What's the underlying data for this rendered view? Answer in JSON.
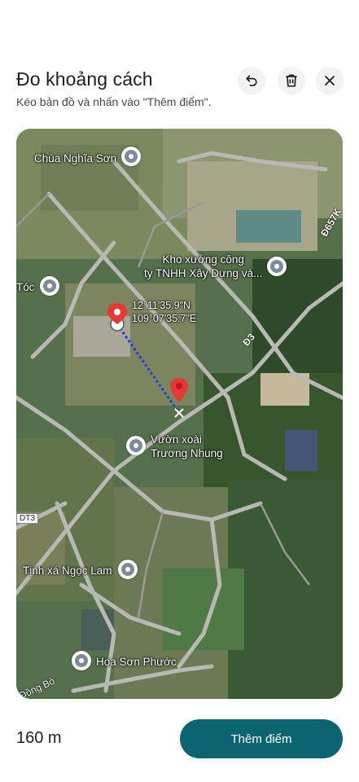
{
  "header": {
    "title": "Đo khoảng cách",
    "subtitle": "Kéo bản đồ và nhấn vào \"Thêm điểm\"."
  },
  "toolbar": {
    "undo_icon": "undo-icon",
    "delete_icon": "trash-icon",
    "close_icon": "close-icon"
  },
  "map": {
    "places": [
      {
        "label": "Chùa Nghĩa Sơn",
        "icon": "temple-icon"
      },
      {
        "label": "Kho xưởng công\nty TNHH Xây Dựng và...",
        "icon": "place-icon"
      },
      {
        "label": "Tóc",
        "icon": "place-icon"
      },
      {
        "label": "Vườn xoài\nTrương Nhung",
        "icon": "place-icon"
      },
      {
        "label": "Tịnh xá Ngọc Lam",
        "icon": "temple-icon"
      },
      {
        "label": "Hoa Sơn Phước",
        "icon": "place-icon"
      }
    ],
    "coordinates": "12°11'35.9\"N\n109°07'35.7\"E",
    "roads": [
      "Đ3",
      "Đ657K",
      "DT3",
      "Đồng Bò"
    ],
    "measure_line_color": "#1a3fe0",
    "pin_color": "#e53935"
  },
  "footer": {
    "distance": "160 m",
    "add_point_label": "Thêm điểm"
  },
  "colors": {
    "accent": "#0b6470"
  }
}
